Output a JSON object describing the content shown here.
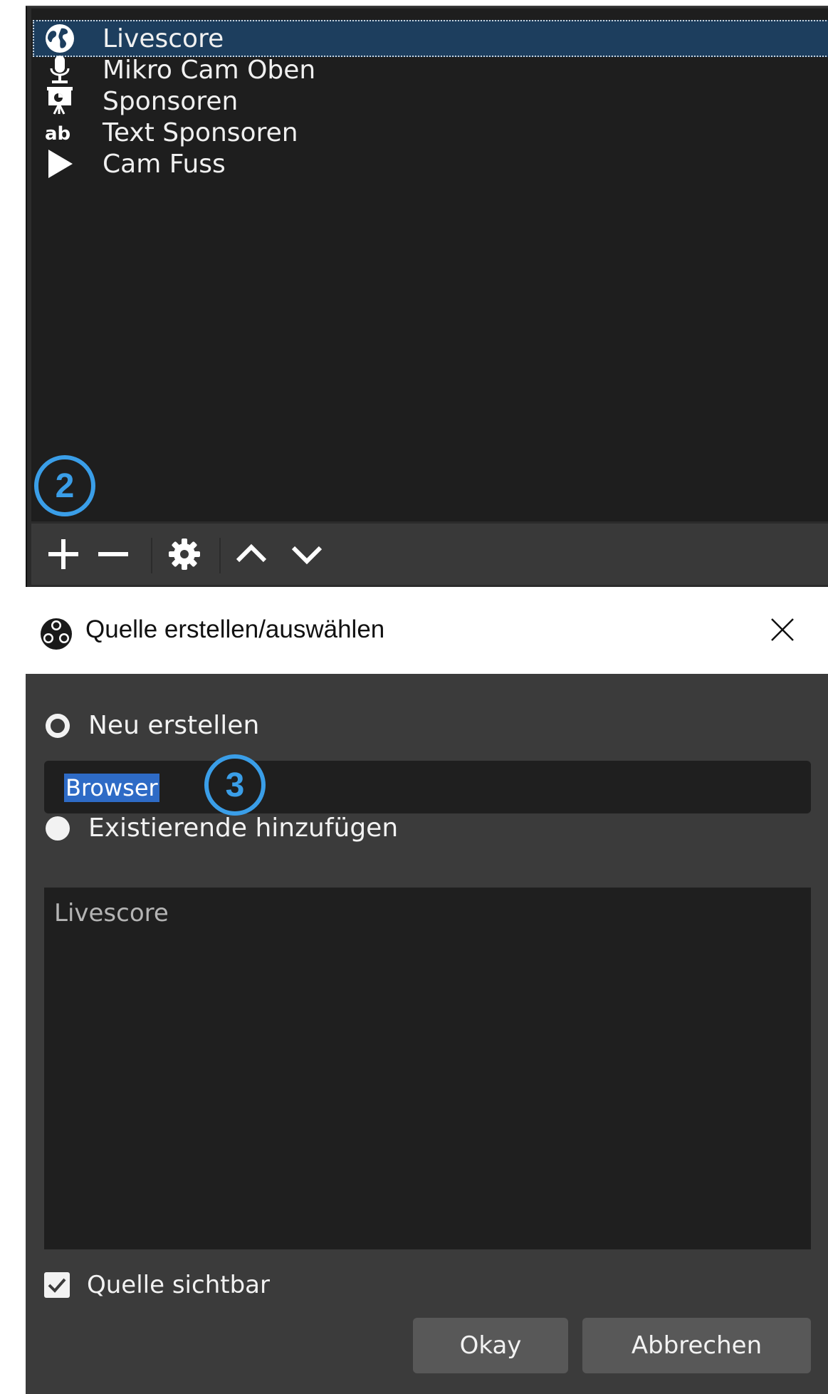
{
  "sources": {
    "items": [
      {
        "label": "Livescore",
        "icon": "globe-icon",
        "selected": true
      },
      {
        "label": "Mikro Cam Oben",
        "icon": "microphone-icon",
        "selected": false
      },
      {
        "label": "Sponsoren",
        "icon": "presentation-board-icon",
        "selected": false
      },
      {
        "label": "Text Sponsoren",
        "icon": "text-ab-icon",
        "selected": false
      },
      {
        "label": "Cam Fuss",
        "icon": "play-icon",
        "selected": false
      }
    ],
    "toolbar": [
      "plus-icon",
      "minus-icon",
      "gear-icon",
      "chevron-up-icon",
      "chevron-down-icon"
    ]
  },
  "annotations": {
    "step2": "2",
    "step3": "3",
    "color": "#3a9ee8"
  },
  "dialog": {
    "title": "Quelle erstellen/auswählen",
    "create_new_label": "Neu erstellen",
    "name_value": "Browser",
    "add_existing_label": "Existierende hinzufügen",
    "existing_items": [
      "Livescore"
    ],
    "visible_label": "Quelle sichtbar",
    "ok_label": "Okay",
    "cancel_label": "Abbrechen"
  },
  "colors": {
    "selection": "#1d3e5e",
    "text_selection": "#2e6bc6",
    "panel": "#1e1e1e",
    "dialog_bg": "#3b3b3b"
  }
}
